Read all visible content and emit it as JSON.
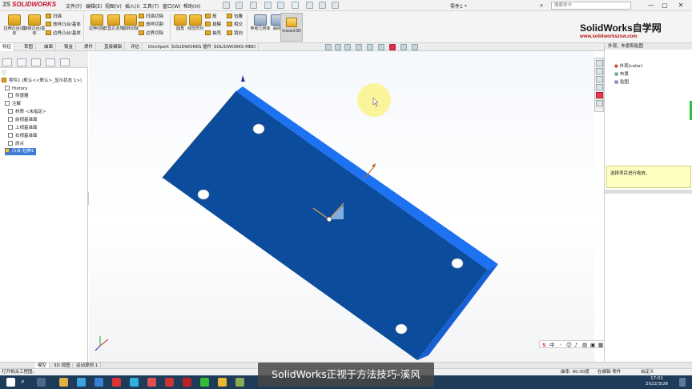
{
  "app": {
    "logo_prefix": "3S",
    "logo_text": "SOLIDWORKS",
    "menus": [
      "文件(F)",
      "编辑(E)",
      "视图(V)",
      "插入(I)",
      "工具(T)",
      "窗口(W)",
      "帮助(H)"
    ],
    "document_title": "零件1 *",
    "search_placeholder": "搜索命令",
    "window_buttons": [
      "—",
      "▢",
      "✕"
    ]
  },
  "ribbon": {
    "big_buttons": [
      {
        "label": "拉伸凸台/基体"
      },
      {
        "label": "旋转凸台/基体"
      },
      {
        "label": "拉伸切除"
      },
      {
        "label": "异型孔向导"
      },
      {
        "label": "旋转切除"
      },
      {
        "label": "圆角"
      },
      {
        "label": "线性阵列"
      },
      {
        "label": "参考几何体"
      },
      {
        "label": "曲线"
      },
      {
        "label": "Instant3D"
      }
    ],
    "small_buttons": {
      "scan": "扫描",
      "loft_boss": "放样凸台/基体",
      "boundary_boss": "边界凸台/基体",
      "swept_cut": "扫描切除",
      "lofted_cut": "放样切割",
      "boundary_cut": "边界切除",
      "rib": "筋",
      "draft": "拔模",
      "shell": "抽壳",
      "wrap": "包覆",
      "intersect": "相交",
      "mirror": "镜向"
    }
  },
  "tabs": [
    "特征",
    "草图",
    "曲面",
    "钣金",
    "焊件",
    "直接编辑",
    "评估",
    "DimXpert",
    "SOLIDWORKS 插件",
    "SOLIDWORKS MBD"
  ],
  "banner": {
    "title": "SolidWorks自学网",
    "url": "www.solidworkszxw.com"
  },
  "feature_tree": {
    "root": "零件1 (默认<<默认>_显示状态 1>)",
    "items": [
      "History",
      "传感器",
      "注解",
      "材质 <未指定>",
      "前视基准面",
      "上视基准面",
      "右视基准面",
      "原点",
      "凸台-拉伸1"
    ]
  },
  "right_panel": {
    "header": "外观、布景和贴图",
    "items": [
      "外观(color)",
      "布景",
      "贴图"
    ],
    "hint": "选择项目进行拖放。"
  },
  "bottom_tabs": [
    "模型",
    "3D 视图",
    "运动算例 1"
  ],
  "status": {
    "left": "打开相关工程图。",
    "zoom": "曲率: 90.00度",
    "mode": "在编辑 零件",
    "custom": "自定义"
  },
  "subtitle": "SolidWorks正视于方法技巧-溪风",
  "taskbar": {
    "time": "17:01",
    "date": "2022/3/26"
  },
  "ime": {
    "logo": "S",
    "mode": "中"
  },
  "colors": {
    "part_face": "#0a4a9a",
    "part_edge": "#1e73f0",
    "taskbar": "#1f3b5a",
    "accent": "#3d7bd6"
  }
}
